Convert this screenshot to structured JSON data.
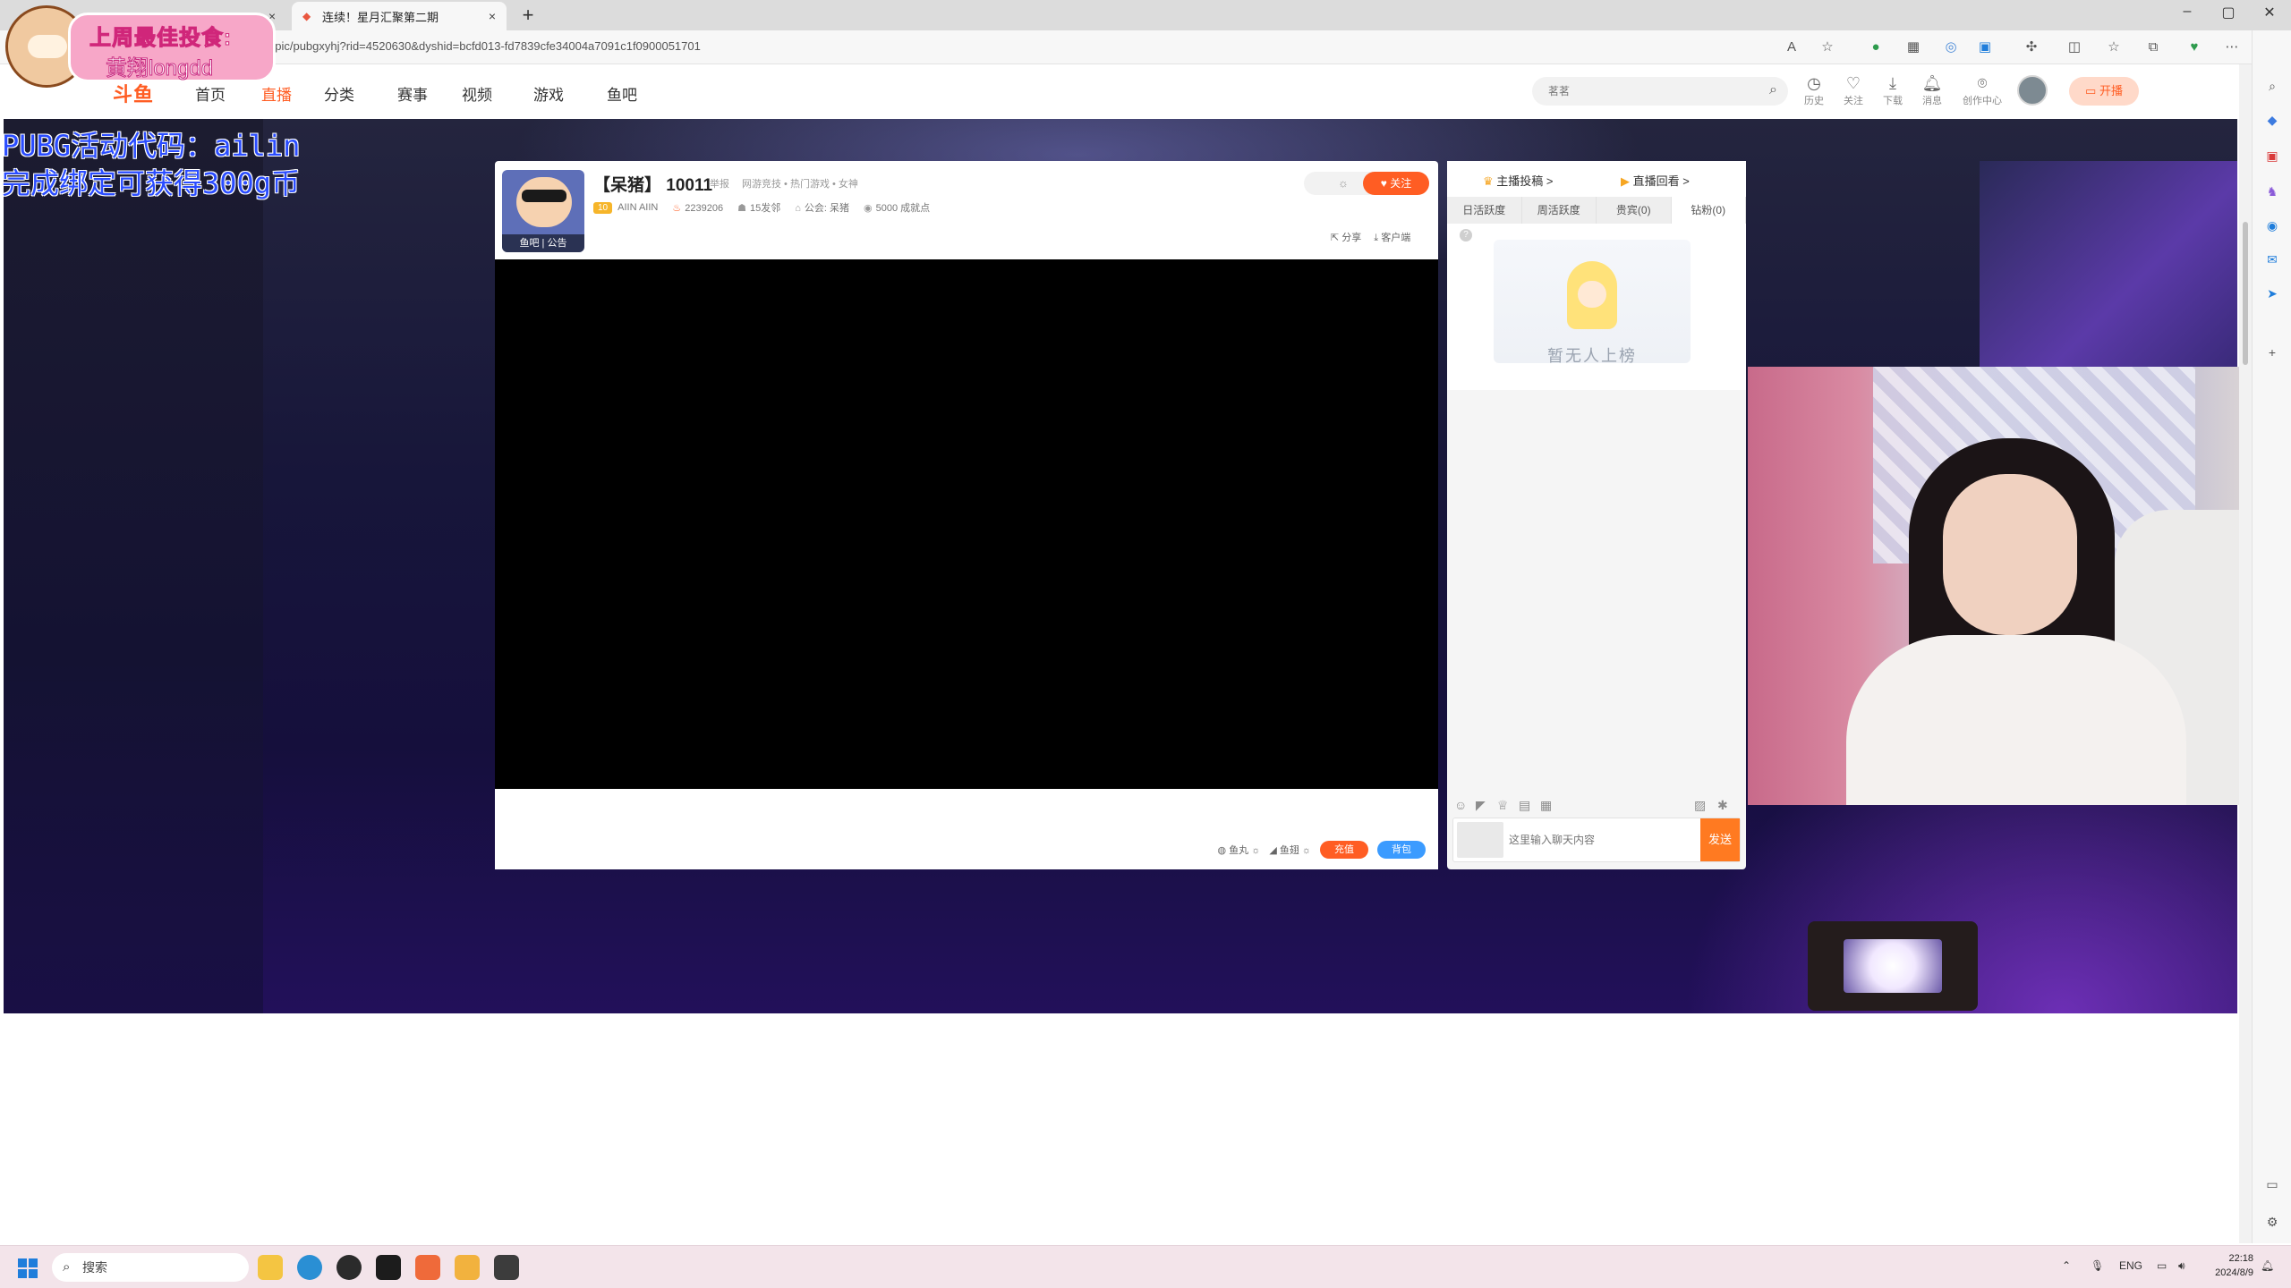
{
  "browser": {
    "tabs": [
      {
        "title": "",
        "close": "×",
        "active": false
      },
      {
        "title": "连续！星月汇聚第二期",
        "close": "×",
        "active": true
      }
    ],
    "new_tab": "+",
    "url": "opic/pubgxyhj?rid=4520630&dyshid=bcfd013-fd7839cfe34004a7091c1f0900051701",
    "window_controls": {
      "minimize": "–",
      "maximize": "▢",
      "close": "✕"
    }
  },
  "sticker": {
    "line1": "上周最佳投食:",
    "line2": "黄翔longdd"
  },
  "overlay_text": {
    "line1": "PUBG活动代码：ailin",
    "line2": "完成绑定可获得300g币"
  },
  "site": {
    "logo": "斗鱼",
    "nav": [
      "首页",
      "直播",
      "分类",
      "赛事",
      "视频",
      "游戏",
      "鱼吧"
    ],
    "nav_current": "直播",
    "search_placeholder": "茗茗",
    "header_icons": [
      {
        "icon": "history-icon",
        "label": "历史"
      },
      {
        "icon": "heart-icon",
        "label": "关注"
      },
      {
        "icon": "download-icon",
        "label": "下载"
      },
      {
        "icon": "bell-icon",
        "label": "消息"
      },
      {
        "icon": "lightbulb-icon",
        "label": "创作中心"
      }
    ],
    "start_live": "开播"
  },
  "room": {
    "title": "【呆猪】 10011",
    "report": "举报",
    "category": "网游竞技 • 热门游戏 • 女神",
    "avatar_tags": "鱼吧 | 公告",
    "level_badge": "10",
    "anchor_tag": "AIIN AIIN",
    "heat": "2239206",
    "fans": "15发邻",
    "guild": "公会: 呆猪",
    "achievement": "5000 成就点",
    "follow": "关注",
    "share": "分享",
    "client": "客户端",
    "gift_bar": {
      "yuwan": "鱼丸",
      "yuchi": "鱼翅",
      "recharge": "充值",
      "backpack": "背包"
    }
  },
  "chat": {
    "anchor_contribution": "主播投稿 >",
    "replay": "直播回看 >",
    "rank_tabs": [
      "日活跃度",
      "周活跃度",
      "贵宾(0)",
      "钻粉(0)"
    ],
    "rank_tab_selected": "钻粉(0)",
    "empty_text": "暂无人上榜",
    "input_placeholder": "这里输入聊天内容",
    "send": "发送"
  },
  "taskbar": {
    "search": "搜索",
    "lang": "ENG",
    "time": "22:18",
    "date": "2024/8/9"
  },
  "colors": {
    "accent": "#ff5d23",
    "send_button": "#ff7a21",
    "backpack_button": "#3b9bff",
    "overlay_text": "#2a4cff"
  }
}
